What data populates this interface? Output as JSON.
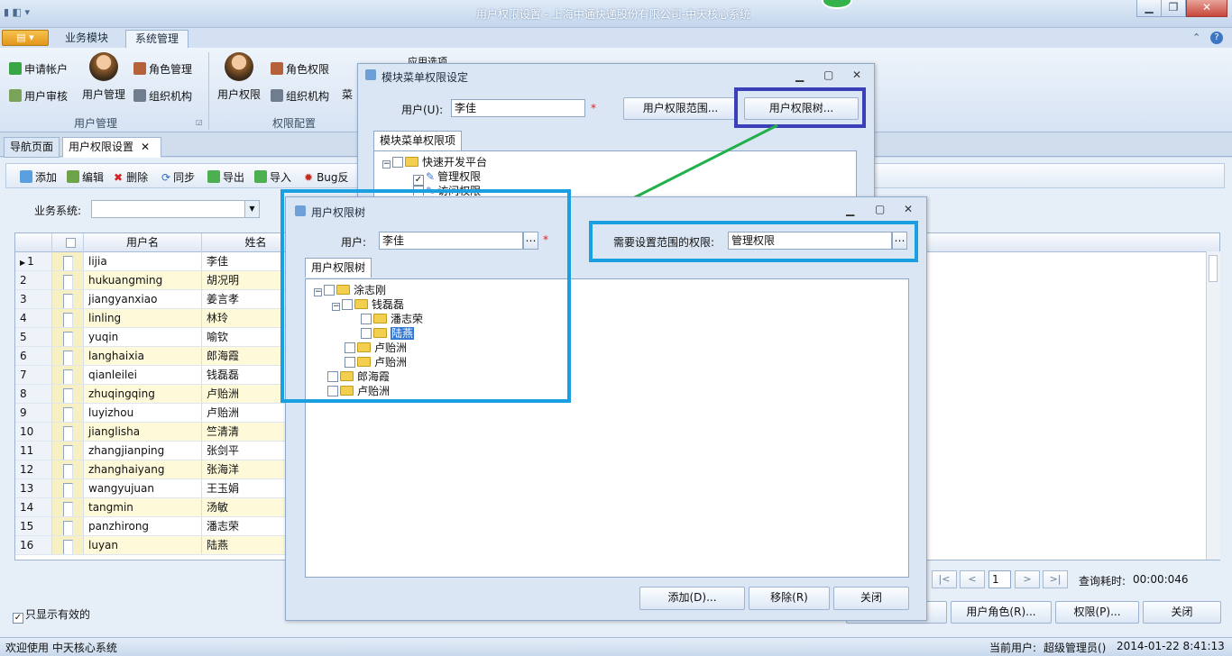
{
  "window": {
    "title": "用户权限设置 - 上海中通快递股份有限公司-中天核心系统",
    "min": "▁",
    "restore": "❐",
    "close": "✕"
  },
  "qat": {
    "label": "▮ ◧ ▾"
  },
  "ribbon_tabs": [
    {
      "label": "业务模块"
    },
    {
      "label": "系统管理"
    }
  ],
  "ribbon": {
    "user_group": {
      "apply_account": "申请帐户",
      "user_audit": "用户审核",
      "user_manage": "用户管理",
      "role_manage": "角色管理",
      "org": "组织机构",
      "label": "用户管理"
    },
    "perm_group": {
      "user_perm": "用户权限",
      "role_perm": "角色权限",
      "org": "组织机构",
      "menu": "菜",
      "label": "权限配置"
    },
    "app_opts": "应用选项"
  },
  "doc_tabs": [
    {
      "label": "导航页面"
    },
    {
      "label": "用户权限设置"
    }
  ],
  "toolbar": {
    "add": "添加",
    "edit": "编辑",
    "delete": "删除",
    "sync": "同步",
    "export": "导出",
    "import": "导入",
    "bug": "Bug反"
  },
  "filter": {
    "system_label": "业务系统:",
    "system_value": ""
  },
  "grid": {
    "headers": [
      "用户名",
      "姓名"
    ],
    "rows": [
      {
        "no": "1",
        "username": "lijia",
        "name": "李佳"
      },
      {
        "no": "2",
        "username": "hukuangming",
        "name": "胡况明"
      },
      {
        "no": "3",
        "username": "jiangyanxiao",
        "name": "姜言孝"
      },
      {
        "no": "4",
        "username": "linling",
        "name": "林玲"
      },
      {
        "no": "5",
        "username": "yuqin",
        "name": "喻钦"
      },
      {
        "no": "6",
        "username": "langhaixia",
        "name": "郎海霞"
      },
      {
        "no": "7",
        "username": "qianleilei",
        "name": "钱磊磊"
      },
      {
        "no": "8",
        "username": "zhuqingqing",
        "name": "卢贻洲"
      },
      {
        "no": "9",
        "username": "luyizhou",
        "name": "卢贻洲"
      },
      {
        "no": "10",
        "username": "jianglisha",
        "name": "竺清清"
      },
      {
        "no": "11",
        "username": "zhangjianping",
        "name": "张剑平"
      },
      {
        "no": "12",
        "username": "zhanghaiyang",
        "name": "张海洋"
      },
      {
        "no": "13",
        "username": "wangyujuan",
        "name": "王玉娟"
      },
      {
        "no": "14",
        "username": "tangmin",
        "name": "汤敏"
      },
      {
        "no": "15",
        "username": "panzhirong",
        "name": "潘志荣"
      },
      {
        "no": "16",
        "username": "luyan",
        "name": "陆燕"
      }
    ]
  },
  "only_valid": {
    "label": "只显示有效的",
    "checked": true
  },
  "pager": {
    "first": "|<",
    "prev": "<",
    "page": "1",
    "next": ">",
    "last": ">|",
    "query_time_label": "查询耗时:",
    "query_time": "00:00:046"
  },
  "bottom_buttons": {
    "more": ".",
    "user_role": "用户角色(R)...",
    "perm": "权限(P)...",
    "close": "关闭"
  },
  "status": {
    "welcome": "欢迎使用 中天核心系统",
    "current_user_label": "当前用户:",
    "current_user": "超级管理员()",
    "datetime": "2014-01-22 8:41:13"
  },
  "menu_dialog": {
    "title": "模块菜单权限设定",
    "user_label": "用户(U):",
    "user_value": "李佳",
    "required": "*",
    "range_button": "用户权限范围...",
    "tree_button": "用户权限树...",
    "tab": "模块菜单权限项",
    "tree": [
      {
        "label": "快速开发平台",
        "checked": false
      },
      {
        "label": "管理权限",
        "checked": true
      },
      {
        "label": "访问权限",
        "checked": false
      }
    ]
  },
  "tree_dialog": {
    "title": "用户权限树",
    "user_label": "用户:",
    "user_value": "李佳",
    "required": "*",
    "scope_label": "需要设置范围的权限:",
    "scope_value": "管理权限",
    "tab": "用户权限树",
    "tree": [
      {
        "label": "涂志刚"
      },
      {
        "label": "钱磊磊"
      },
      {
        "label": "潘志荣"
      },
      {
        "label": "陆燕",
        "selected": true
      },
      {
        "label": "卢贻洲"
      },
      {
        "label": "卢贻洲"
      },
      {
        "label": "郎海霞"
      },
      {
        "label": "卢贻洲"
      }
    ],
    "add_button": "添加(D)...",
    "remove_button": "移除(R)",
    "close_button": "关闭"
  },
  "dialog_controls": {
    "min": "▁",
    "max": "▢",
    "close": "✕"
  },
  "colors": {
    "accent_blue": "#1aa0e0",
    "accent_purple": "#3b3fb8",
    "connector_green": "#22b04a"
  }
}
